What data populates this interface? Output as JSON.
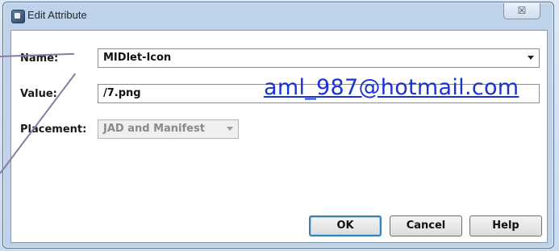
{
  "window": {
    "title": "Edit Attribute",
    "close_glyph": "☒"
  },
  "form": {
    "name_label": "Name:",
    "name_value": "MIDlet-Icon",
    "value_label": "Value:",
    "value_value": "/7.png",
    "placement_label": "Placement:",
    "placement_value": "JAD and Manifest"
  },
  "overlay": {
    "email": "aml_987@hotmail.com"
  },
  "buttons": {
    "ok": "OK",
    "cancel": "Cancel",
    "help": "Help"
  },
  "icons": [
    "app-icon",
    "close-icon",
    "dropdown-arrow-icon"
  ],
  "colors": {
    "link": "#1a33d6",
    "default_button_border": "#3c7fb1",
    "annotation_line": "#8a7aa6"
  }
}
